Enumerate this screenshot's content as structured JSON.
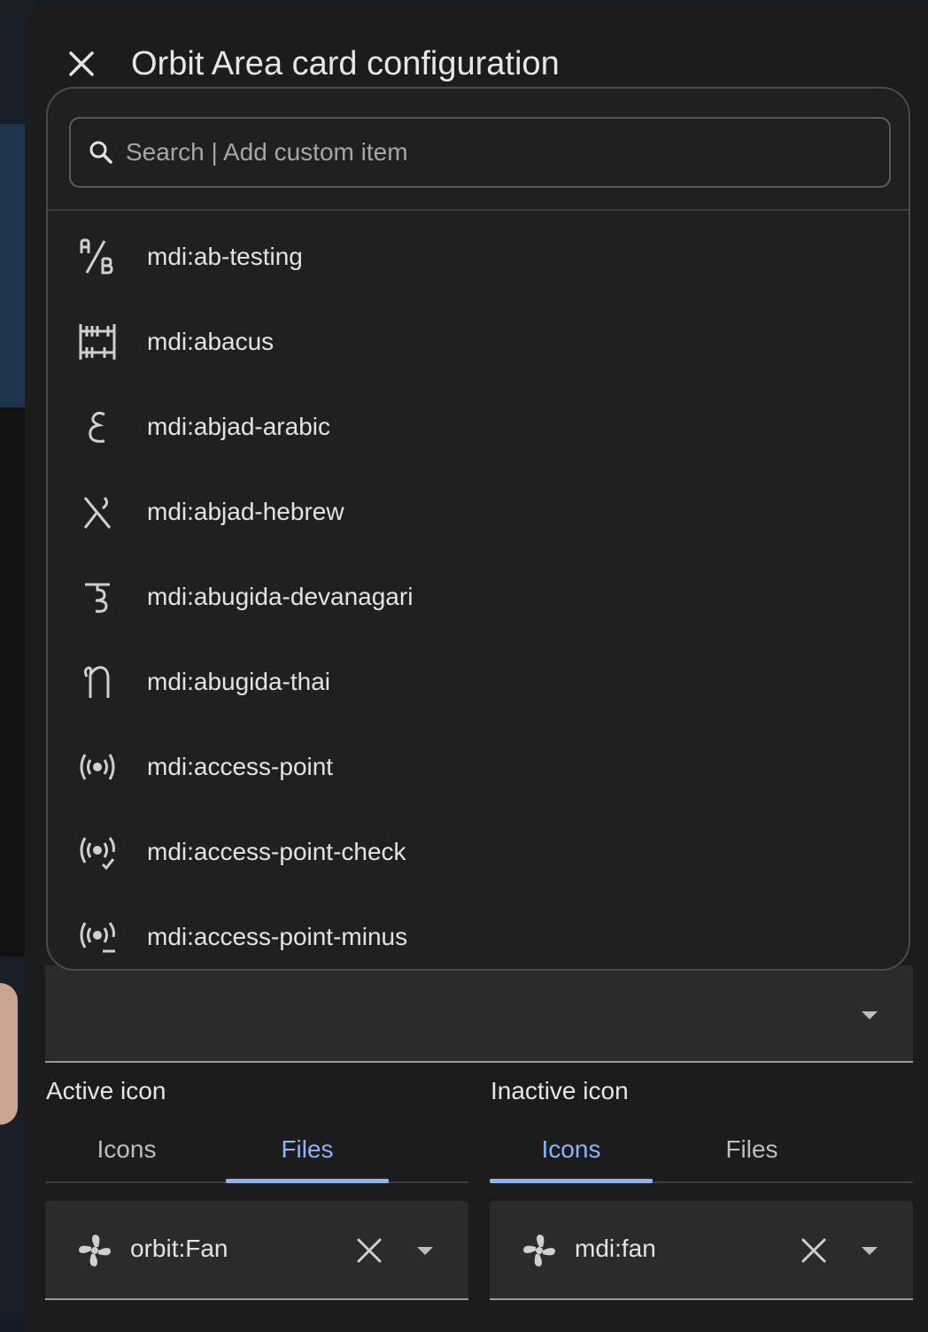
{
  "dialog": {
    "title": "Orbit Area card configuration",
    "close_icon": "close-icon"
  },
  "picker": {
    "search_placeholder": "Search | Add custom item",
    "items": [
      {
        "label": "mdi:ab-testing",
        "icon": "ab-testing-icon"
      },
      {
        "label": "mdi:abacus",
        "icon": "abacus-icon"
      },
      {
        "label": "mdi:abjad-arabic",
        "icon": "abjad-arabic-icon"
      },
      {
        "label": "mdi:abjad-hebrew",
        "icon": "abjad-hebrew-icon"
      },
      {
        "label": "mdi:abugida-devanagari",
        "icon": "abugida-devanagari-icon"
      },
      {
        "label": "mdi:abugida-thai",
        "icon": "abugida-thai-icon"
      },
      {
        "label": "mdi:access-point",
        "icon": "access-point-icon"
      },
      {
        "label": "mdi:access-point-check",
        "icon": "access-point-check-icon"
      },
      {
        "label": "mdi:access-point-minus",
        "icon": "access-point-minus-icon"
      }
    ]
  },
  "active_icon": {
    "label": "Active icon",
    "tabs": [
      "Icons",
      "Files"
    ],
    "selected_tab": "Files",
    "value": "orbit:Fan"
  },
  "inactive_icon": {
    "label": "Inactive icon",
    "tabs": [
      "Icons",
      "Files"
    ],
    "selected_tab": "Icons",
    "value": "mdi:fan"
  },
  "colors": {
    "accent": "#8ab4f8",
    "surface": "#1c1c1c",
    "field": "#2b2b2b"
  }
}
